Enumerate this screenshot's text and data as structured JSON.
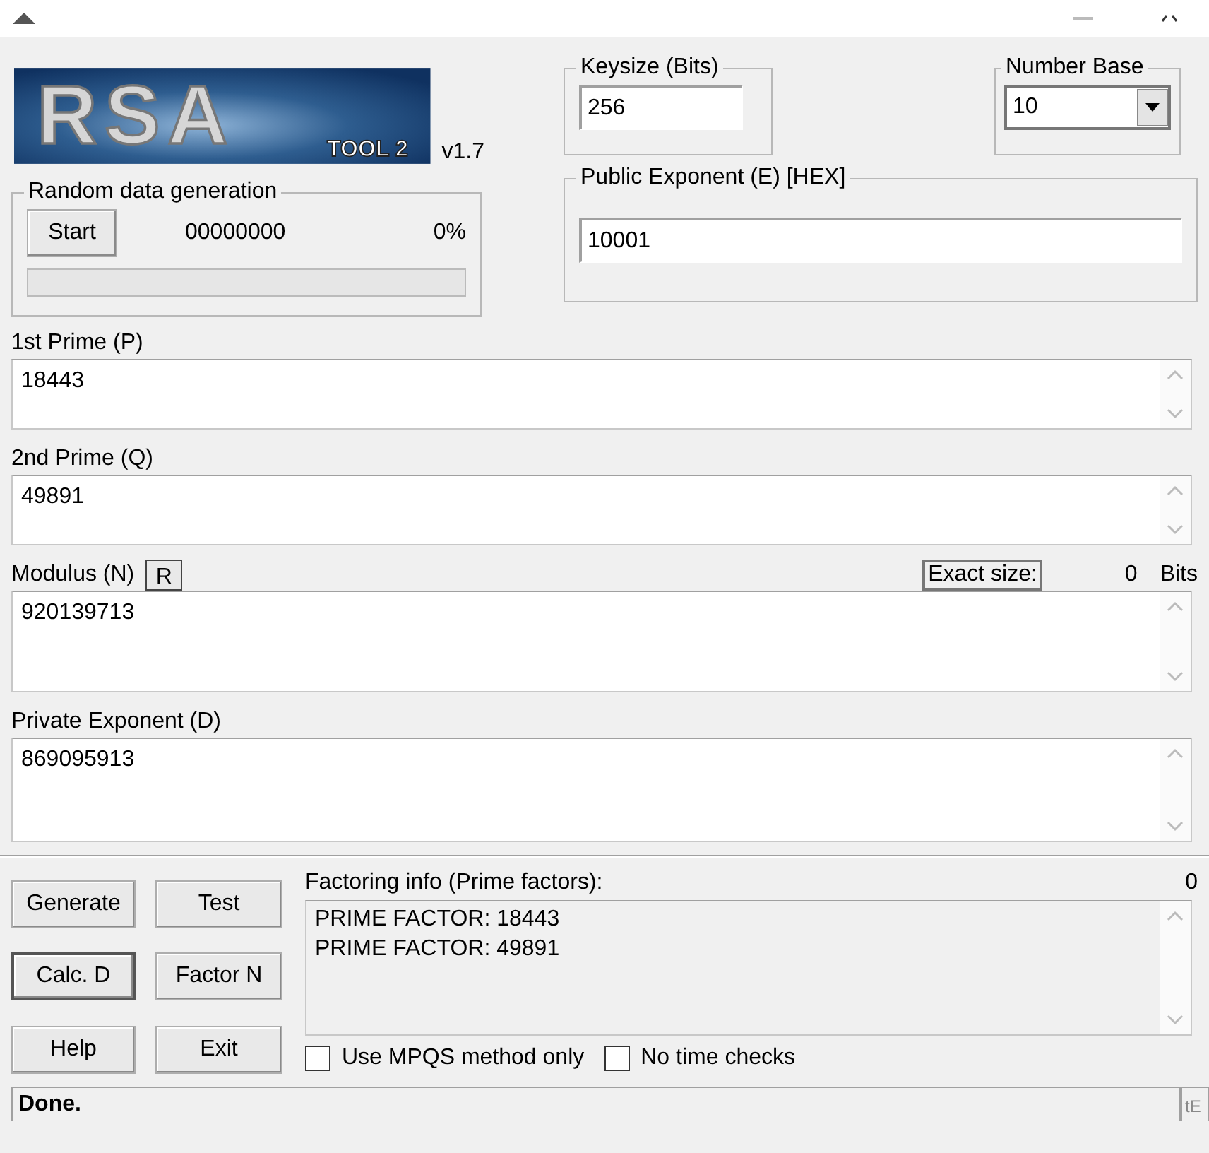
{
  "logo": {
    "title": "RSA",
    "subtitle": "TOOL 2",
    "version": "v1.7"
  },
  "keysize": {
    "label": "Keysize (Bits)",
    "value": "256"
  },
  "number_base": {
    "label": "Number Base",
    "value": "10"
  },
  "random": {
    "label": "Random data generation",
    "button": "Start",
    "counter": "00000000",
    "percent": "0%",
    "level": 0
  },
  "public_exponent": {
    "label": "Public Exponent (E) [HEX]",
    "value": "10001"
  },
  "fields": [
    {
      "kind": "plain",
      "label": "1st Prime (P)",
      "value": "18443"
    },
    {
      "kind": "plain",
      "label": "2nd Prime (Q)",
      "value": "49891"
    },
    {
      "kind": "modulus",
      "label": "Modulus (N)",
      "value": "920139713",
      "r_button": "R",
      "exact_size_label": "Exact size:",
      "exact_size_value": "0",
      "unit": "Bits"
    },
    {
      "kind": "plain",
      "label": "Private Exponent (D)",
      "value": "869095913"
    }
  ],
  "buttons": [
    {
      "label": "Generate",
      "default": false
    },
    {
      "label": "Test",
      "default": false
    },
    {
      "label": "Calc. D",
      "default": true
    },
    {
      "label": "Factor N",
      "default": false
    },
    {
      "label": "Help",
      "default": false
    },
    {
      "label": "Exit",
      "default": false
    }
  ],
  "factoring": {
    "label": "Factoring info (Prime factors):",
    "count": "0",
    "lines": [
      "PRIME FACTOR: 18443",
      "PRIME FACTOR: 49891"
    ]
  },
  "options": [
    {
      "label": "Use MPQS method only",
      "checked": false
    },
    {
      "label": "No time checks",
      "checked": false
    }
  ],
  "status_bar": [
    "Done.",
    "tE"
  ]
}
